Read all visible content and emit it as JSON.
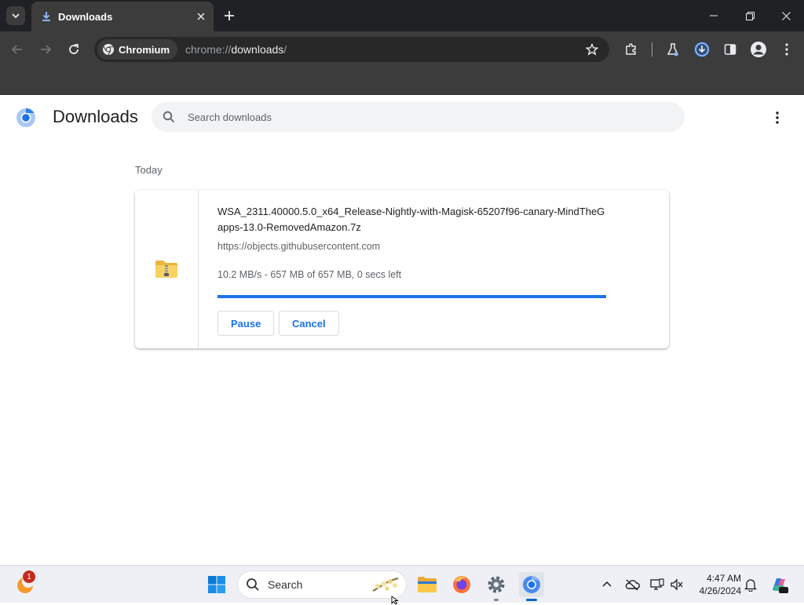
{
  "browser": {
    "tab": {
      "title": "Downloads"
    },
    "omnibox": {
      "chip_label": "Chromium",
      "url_scheme": "chrome://",
      "url_host": "downloads",
      "url_path": "/"
    }
  },
  "page": {
    "title": "Downloads",
    "search": {
      "placeholder": "Search downloads"
    },
    "date_header": "Today",
    "download": {
      "filename": "WSA_2311.40000.5.0_x64_Release-Nightly-with-Magisk-65207f96-canary-MindTheGapps-13.0-RemovedAmazon.7z",
      "url": "https://objects.githubusercontent.com",
      "status": "10.2 MB/s - 657 MB of 657 MB, 0 secs left",
      "progress_percent": 100,
      "pause_label": "Pause",
      "cancel_label": "Cancel"
    }
  },
  "taskbar": {
    "weather_badge": "1",
    "search_label": "Search",
    "time": "4:47 AM",
    "date": "4/26/2024"
  },
  "colors": {
    "accent": "#1a73e8",
    "chrome_dark": "#202124",
    "toolbar": "#3c3c3c"
  }
}
